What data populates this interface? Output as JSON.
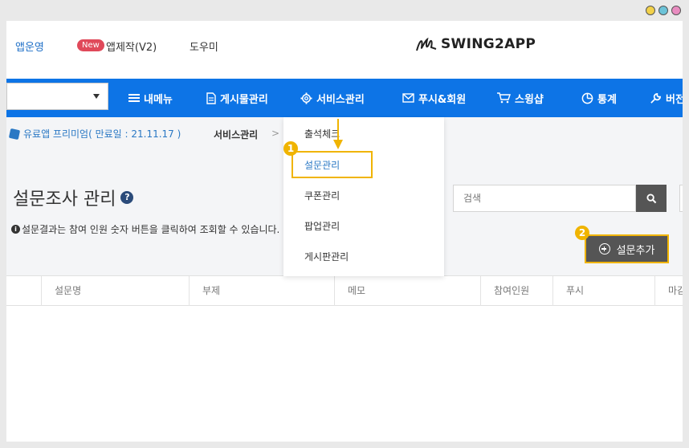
{
  "header": {
    "links": [
      "앱운영",
      "앱제작(V2)",
      "도우미"
    ],
    "new_badge": "New",
    "logo_text": "SWING2APP"
  },
  "nav": {
    "items": [
      "내메뉴",
      "게시물관리",
      "서비스관리",
      "푸시&회원",
      "스윙샵",
      "통계",
      "버전"
    ]
  },
  "breadcrumb": {
    "premium": "유료앱 프리미엄( 만료일 : 21.11.17 )",
    "path": "서비스관리",
    "sep": ">"
  },
  "page": {
    "title": "설문조사 관리",
    "help": "?",
    "notice": "설문결과는 참여 인원 숫자 버튼을 클릭하여 조회할 수 있습니다.",
    "search_placeholder": "검색",
    "add_button": "설문추가"
  },
  "table": {
    "headers": [
      "설문명",
      "부제",
      "메모",
      "참여인원",
      "푸시",
      "마감"
    ]
  },
  "dropdown": {
    "items": [
      "출석체크",
      "설문관리",
      "쿠폰관리",
      "팝업관리",
      "게시판관리"
    ]
  },
  "annotations": {
    "step1": "1",
    "step2": "2"
  },
  "colors": {
    "accent": "#0d74e6",
    "highlight": "#f0b400"
  }
}
